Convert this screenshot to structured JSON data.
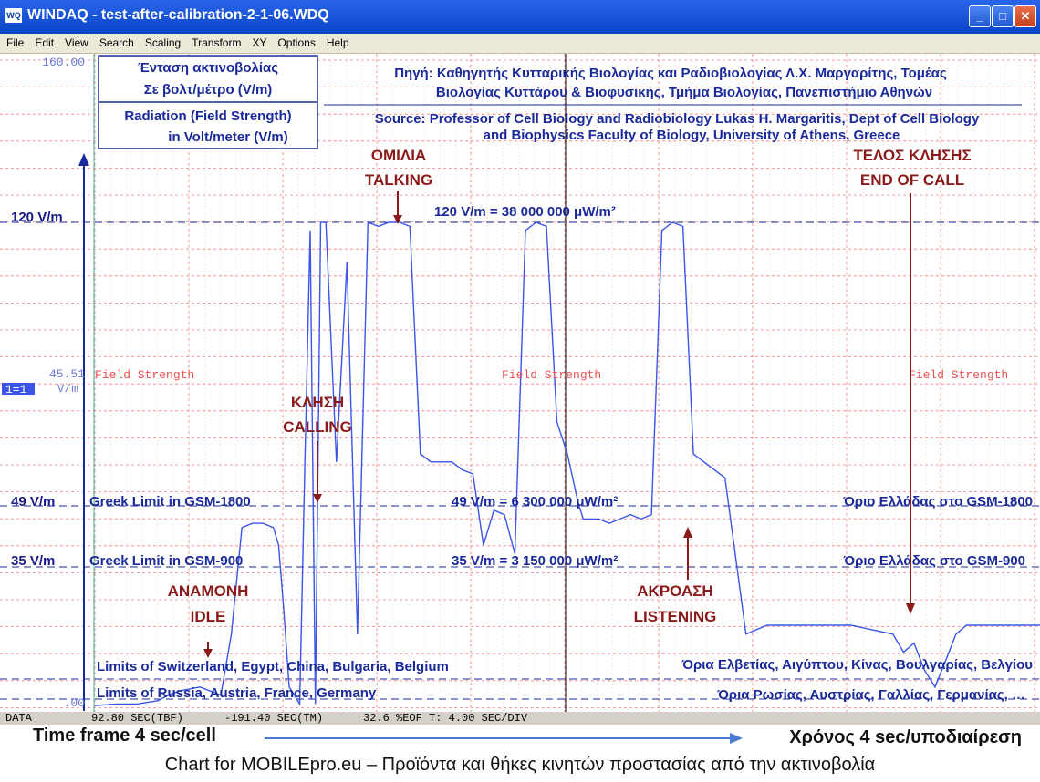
{
  "window": {
    "title": "WINDAQ - test-after-calibration-2-1-06.WDQ",
    "icon": "windaq-app-icon",
    "buttons": [
      "_",
      "□",
      "✕"
    ]
  },
  "menu": [
    "File",
    "Edit",
    "View",
    "Search",
    "Scaling",
    "Transform",
    "XY",
    "Options",
    "Help"
  ],
  "axis": {
    "top_value": "160.00",
    "bottom_value": ".00",
    "mid_value": "45.51",
    "unit": "V/m",
    "channel_tag": "1=1",
    "channel_label": "Field Strength"
  },
  "legend_box": {
    "gr_line1": "Ένταση ακτινοβολίας",
    "gr_line2": "Σε βολτ/μέτρο (V/m)",
    "en_line1": "Radiation (Field Strength)",
    "en_line2": "in Volt/meter (V/m)"
  },
  "source": {
    "gr_line1": "Πηγή: Καθηγητής Κυτταρικής Βιολογίας και Ραδιοβιολογίας Λ.Χ. Μαργαρίτης, Τομέας",
    "gr_line2": "Βιολογίας Κυττάρου & Βιοφυσικής, Τμήμα Βιολογίας,  Πανεπιστήμιο Αθηνών",
    "en_line1": "Source: Professor of Cell Biology and Radiobiology Lukas H. Margaritis, Dept of Cell Biology",
    "en_line2": "and Biophysics Faculty of Biology, University of Athens, Greece"
  },
  "levels": {
    "l120": {
      "label": "120 V/m",
      "center": "120 V/m   =   38 000 000 μW/m²"
    },
    "l49": {
      "label": "49 V/m",
      "left": "Greek Limit in GSM-1800",
      "center": "49 V/m = 6 300 000 μW/m²",
      "right": "Όριο Ελλάδας στο GSM-1800"
    },
    "l35": {
      "label": "35 V/m",
      "left": "Greek Limit in GSM-900",
      "center": "35 V/m = 3 150 000 μW/m²",
      "right": "Όριο Ελλάδας στο GSM-900"
    },
    "swiss": {
      "left": "Limits of Switzerland, Egypt, China, Bulgaria, Belgium",
      "right": "Όρια Ελβετίας, Αιγύπτου, Κίνας, Βουλγαρίας, Βελγίου"
    },
    "russia": {
      "left": "Limits of Russia, Austria, France, Germany",
      "right": "Όρια Ρωσίας, Αυστρίας, Γαλλίας, Γερμανίας, …"
    }
  },
  "phases": {
    "talking": {
      "gr": "ΟΜΙΛΙΑ",
      "en": "TALKING"
    },
    "calling": {
      "gr": "ΚΛΗΣΗ",
      "en": "CALLING"
    },
    "idle": {
      "gr": "ΑΝΑΜΟΝΗ",
      "en": "IDLE"
    },
    "listening": {
      "gr": "ΑΚΡΟΑΣΗ",
      "en": "LISTENING"
    },
    "end": {
      "gr": "ΤΕΛΟΣ ΚΛΗΣΗΣ",
      "en": "END OF CALL"
    }
  },
  "status": {
    "a": "DATA",
    "b": "92.80 SEC(TBF)",
    "c": "-191.40 SEC(TM)",
    "d": "32.6 %EOF T: 4.00 SEC/DIV"
  },
  "timeframe": {
    "left": "Time frame 4 sec/cell",
    "right": "Χρόνος 4 sec/υποδιαίρεση"
  },
  "footer": "Chart for MOBILEpro.eu – Προϊόντα και θήκες κινητών προστασίας από την ακτινοβολία",
  "colors": {
    "grid": "#f08080",
    "trace": "#3a55e8",
    "text_blue": "#1a2a9a",
    "text_red": "#8b1a1a",
    "title_blue": "#0a45c8"
  },
  "chart_data": {
    "type": "line",
    "title": "",
    "xlabel": "Time frame 4 sec/cell",
    "ylabel": "V/m",
    "ylim": [
      0,
      160
    ],
    "x_unit": "s",
    "reference_lines": [
      120,
      49,
      35,
      10,
      5
    ],
    "series": [
      {
        "x": [
          0,
          4,
          8,
          10,
          12,
          14,
          16,
          20,
          22,
          24,
          26,
          28,
          30,
          32,
          34,
          35,
          36,
          37,
          38,
          39,
          40,
          41,
          42,
          43,
          44,
          46,
          48,
          50,
          52,
          54,
          56,
          58,
          60,
          62,
          64,
          66,
          68,
          70,
          72,
          74,
          76,
          78,
          80,
          82,
          84,
          86,
          88,
          90,
          92,
          93,
          94,
          95,
          96,
          98,
          100,
          102,
          104,
          106,
          108,
          110,
          112,
          114,
          116,
          118,
          120,
          124,
          128,
          132,
          136,
          140,
          144,
          148,
          152,
          154,
          156,
          158,
          160,
          162,
          164,
          166,
          168,
          170,
          174,
          178,
          180
        ],
        "y": [
          1,
          2,
          2,
          3,
          4,
          6,
          7,
          8,
          7,
          6,
          20,
          44,
          45,
          45,
          44,
          40,
          25,
          8,
          6,
          2,
          60,
          118,
          2,
          120,
          120,
          60,
          110,
          20,
          120,
          119,
          120,
          120,
          119,
          62,
          60,
          60,
          60,
          58,
          57,
          40,
          48,
          47,
          38,
          118,
          120,
          119,
          70,
          62,
          50,
          46,
          46,
          46,
          46,
          45,
          46,
          47,
          46,
          47,
          118,
          120,
          119,
          62,
          60,
          58,
          56,
          20,
          22,
          22,
          22,
          22,
          22,
          21,
          20,
          16,
          18,
          12,
          8,
          14,
          20,
          22,
          22,
          22,
          22,
          22,
          22
        ]
      }
    ]
  }
}
